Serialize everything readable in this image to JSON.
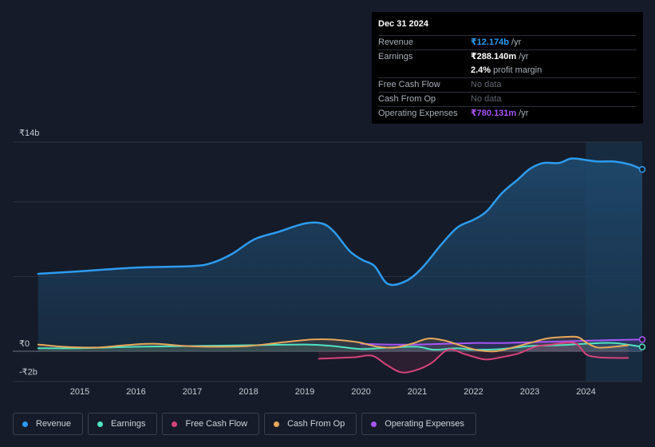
{
  "tooltip": {
    "date": "Dec 31 2024",
    "rows": [
      {
        "label": "Revenue",
        "value": "₹12.174b",
        "unit": "/yr",
        "color": "#2d9cf0"
      },
      {
        "label": "Earnings",
        "value": "₹288.140m",
        "unit": "/yr",
        "color": "#ffffff"
      },
      {
        "label": "",
        "value": "2.4%",
        "unit": "profit margin",
        "color": "#ffffff"
      },
      {
        "label": "Free Cash Flow",
        "value": "No data",
        "unit": "",
        "color": "#5e6470"
      },
      {
        "label": "Cash From Op",
        "value": "No data",
        "unit": "",
        "color": "#5e6470"
      },
      {
        "label": "Operating Expenses",
        "value": "₹780.131m",
        "unit": "/yr",
        "color": "#a855f7"
      }
    ]
  },
  "legend": [
    {
      "label": "Revenue",
      "color": "#2d9cf0"
    },
    {
      "label": "Earnings",
      "color": "#4fe3c1"
    },
    {
      "label": "Free Cash Flow",
      "color": "#d6437a"
    },
    {
      "label": "Cash From Op",
      "color": "#e8a85a"
    },
    {
      "label": "Operating Expenses",
      "color": "#a855f7"
    }
  ],
  "chart_data": {
    "type": "area",
    "title": "",
    "xlabel": "",
    "ylabel": "",
    "ylim": [
      -2,
      14
    ],
    "y_tick_labels": [
      {
        "value": 14,
        "label": "₹14b"
      },
      {
        "value": 0,
        "label": "₹0"
      },
      {
        "value": -2,
        "label": "-₹2b"
      }
    ],
    "gridlines": [
      14,
      10,
      5,
      0
    ],
    "x_ticks": [
      2015,
      2016,
      2017,
      2018,
      2019,
      2020,
      2021,
      2022,
      2023,
      2024
    ],
    "xlim": [
      2014.26,
      2025.0
    ],
    "highlight_start": 2024.0,
    "units": "₹ billions",
    "series": [
      {
        "name": "Revenue",
        "color": "#2d9cf0",
        "fill": true,
        "x": [
          2014.26,
          2015.0,
          2016.0,
          2017.0,
          2017.34,
          2017.7,
          2018.11,
          2018.54,
          2019.0,
          2019.31,
          2019.52,
          2019.8,
          2020.03,
          2020.24,
          2020.48,
          2020.8,
          2021.09,
          2021.44,
          2021.72,
          2022.0,
          2022.23,
          2022.51,
          2022.79,
          2023.0,
          2023.24,
          2023.52,
          2023.74,
          2024.0,
          2024.21,
          2024.5,
          2024.78,
          2025.0
        ],
        "y": [
          5.18,
          5.35,
          5.6,
          5.7,
          5.9,
          6.5,
          7.5,
          8.0,
          8.55,
          8.55,
          8.0,
          6.7,
          6.1,
          5.7,
          4.5,
          4.7,
          5.6,
          7.2,
          8.3,
          8.8,
          9.35,
          10.6,
          11.5,
          12.2,
          12.6,
          12.6,
          12.9,
          12.8,
          12.7,
          12.7,
          12.5,
          12.17
        ]
      },
      {
        "name": "Earnings",
        "color": "#4fe3c1",
        "fill": false,
        "x": [
          2014.26,
          2015.0,
          2016.0,
          2017.0,
          2018.0,
          2019.0,
          2019.5,
          2020.0,
          2020.5,
          2021.0,
          2021.3,
          2021.7,
          2022.0,
          2022.5,
          2023.0,
          2023.5,
          2024.0,
          2024.5,
          2025.0
        ],
        "y": [
          0.2,
          0.2,
          0.3,
          0.35,
          0.4,
          0.45,
          0.35,
          0.15,
          0.25,
          0.3,
          0.1,
          0.2,
          0.1,
          0.15,
          0.35,
          0.4,
          0.5,
          0.55,
          0.29
        ]
      },
      {
        "name": "Free Cash Flow",
        "color": "#d6437a",
        "fill": false,
        "x": [
          2019.25,
          2019.6,
          2019.9,
          2020.2,
          2020.45,
          2020.7,
          2020.95,
          2021.25,
          2021.55,
          2021.85,
          2022.2,
          2022.5,
          2022.8,
          2023.1,
          2023.4,
          2023.8,
          2024.0,
          2024.2,
          2024.5,
          2024.75
        ],
        "y": [
          -0.5,
          -0.45,
          -0.4,
          -0.3,
          -0.9,
          -1.4,
          -1.3,
          -0.8,
          0.1,
          -0.2,
          -0.55,
          -0.4,
          -0.15,
          0.3,
          0.45,
          0.55,
          -0.2,
          -0.4,
          -0.45,
          -0.45
        ]
      },
      {
        "name": "Cash From Op",
        "color": "#e8a85a",
        "fill": false,
        "x": [
          2014.26,
          2014.7,
          2015.3,
          2015.8,
          2016.3,
          2016.9,
          2017.4,
          2018.0,
          2018.5,
          2019.0,
          2019.3,
          2019.6,
          2019.95,
          2020.3,
          2020.6,
          2020.9,
          2021.2,
          2021.5,
          2021.8,
          2022.1,
          2022.4,
          2022.7,
          2023.0,
          2023.3,
          2023.6,
          2023.85,
          2024.0,
          2024.2,
          2024.5,
          2024.75
        ],
        "y": [
          0.45,
          0.3,
          0.25,
          0.4,
          0.5,
          0.35,
          0.3,
          0.35,
          0.55,
          0.75,
          0.8,
          0.75,
          0.6,
          0.3,
          0.25,
          0.5,
          0.85,
          0.7,
          0.35,
          0.05,
          0.0,
          0.25,
          0.55,
          0.85,
          0.95,
          0.95,
          0.6,
          0.25,
          0.3,
          0.4
        ]
      },
      {
        "name": "Operating Expenses",
        "color": "#a855f7",
        "fill": false,
        "x": [
          2020.0,
          2020.5,
          2021.0,
          2021.5,
          2022.0,
          2022.5,
          2023.0,
          2023.5,
          2024.0,
          2024.5,
          2025.0
        ],
        "y": [
          0.5,
          0.45,
          0.45,
          0.5,
          0.55,
          0.55,
          0.6,
          0.65,
          0.7,
          0.75,
          0.78
        ]
      }
    ]
  }
}
